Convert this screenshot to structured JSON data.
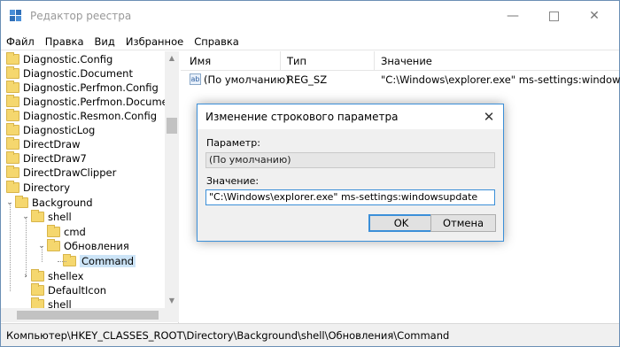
{
  "window": {
    "title": "Редактор реестра",
    "minimize": "—",
    "close": "✕"
  },
  "menu": [
    "Файл",
    "Правка",
    "Вид",
    "Избранное",
    "Справка"
  ],
  "tree": {
    "items": [
      {
        "label": "Diagnostic.Config"
      },
      {
        "label": "Diagnostic.Document"
      },
      {
        "label": "Diagnostic.Perfmon.Config"
      },
      {
        "label": "Diagnostic.Perfmon.Document"
      },
      {
        "label": "Diagnostic.Resmon.Config"
      },
      {
        "label": "DiagnosticLog"
      },
      {
        "label": "DirectDraw"
      },
      {
        "label": "DirectDraw7"
      },
      {
        "label": "DirectDrawClipper"
      },
      {
        "label": "Directory"
      },
      {
        "label": "Background"
      },
      {
        "label": "shell"
      },
      {
        "label": "cmd"
      },
      {
        "label": "Обновления"
      },
      {
        "label": "Command"
      },
      {
        "label": "shellex"
      },
      {
        "label": "DefaultIcon"
      },
      {
        "label": "shell"
      }
    ]
  },
  "list": {
    "columns": [
      "Имя",
      "Тип",
      "Значение"
    ],
    "rows": [
      {
        "icon": "ab",
        "name": "(По умолчанию)",
        "type": "REG_SZ",
        "value": "\"C:\\Windows\\explorer.exe\" ms-settings:windowsu..."
      }
    ]
  },
  "status_path": "Компьютер\\HKEY_CLASSES_ROOT\\Directory\\Background\\shell\\Обновления\\Command",
  "dialog": {
    "title": "Изменение строкового параметра",
    "param_label": "Параметр:",
    "param_value": "(По умолчанию)",
    "value_label": "Значение:",
    "value_text": "\"C:\\Windows\\explorer.exe\" ms-settings:windowsupdate",
    "ok": "OK",
    "cancel": "Отмена",
    "close": "✕"
  },
  "colors": {
    "accent": "#3b8fd8",
    "folder": "#f5d76e",
    "selection": "#cce4f7"
  }
}
